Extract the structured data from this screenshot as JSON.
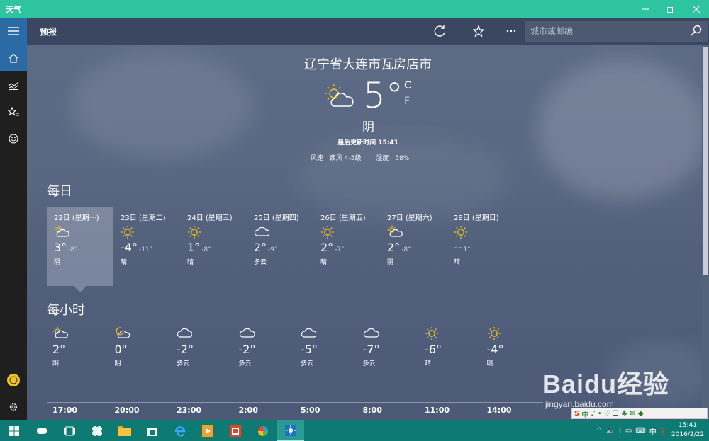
{
  "window": {
    "title": "天气"
  },
  "command_bar": {
    "page_title": "预报",
    "search_placeholder": "城市或邮编"
  },
  "current": {
    "location": "辽宁省大连市瓦房店市",
    "temperature": "5",
    "degree": "°",
    "unit_c": "C",
    "unit_f": "F",
    "condition": "阴",
    "updated": "最后更新时间 15:41",
    "wind_label": "风速",
    "wind_value": "西风 4-5级",
    "humidity_label": "湿度",
    "humidity_value": "58%"
  },
  "daily": {
    "title": "每日",
    "days": [
      {
        "date": "22日 (星期一)",
        "hi": "3°",
        "lo": "-8°",
        "desc": "阴",
        "icon": "partly-cloudy-icon"
      },
      {
        "date": "23日 (星期二)",
        "hi": "-4°",
        "lo": "-11°",
        "desc": "晴",
        "icon": "sun-icon"
      },
      {
        "date": "24日 (星期三)",
        "hi": "1°",
        "lo": "-8°",
        "desc": "晴",
        "icon": "sun-icon"
      },
      {
        "date": "25日 (星期四)",
        "hi": "2°",
        "lo": "-9°",
        "desc": "多云",
        "icon": "cloud-icon"
      },
      {
        "date": "26日 (星期五)",
        "hi": "2°",
        "lo": "-7°",
        "desc": "晴",
        "icon": "sun-icon"
      },
      {
        "date": "27日 (星期六)",
        "hi": "2°",
        "lo": "-8°",
        "desc": "阴",
        "icon": "partly-cloudy-icon"
      },
      {
        "date": "28日 (星期日)",
        "hi": "--",
        "lo": "1°",
        "desc": "晴",
        "icon": "sun-icon"
      }
    ]
  },
  "hourly": {
    "title": "每小时",
    "hours": [
      {
        "temp": "2°",
        "desc": "阴",
        "time": "17:00",
        "icon": "partly-cloudy-icon"
      },
      {
        "temp": "0°",
        "desc": "阴",
        "time": "20:00",
        "icon": "moon-cloud-icon"
      },
      {
        "temp": "-2°",
        "desc": "多云",
        "time": "23:00",
        "icon": "cloud-icon"
      },
      {
        "temp": "-2°",
        "desc": "多云",
        "time": "2:00",
        "icon": "cloud-icon"
      },
      {
        "temp": "-5°",
        "desc": "多云",
        "time": "5:00",
        "icon": "cloud-icon"
      },
      {
        "temp": "-7°",
        "desc": "多云",
        "time": "8:00",
        "icon": "cloud-icon"
      },
      {
        "temp": "-6°",
        "desc": "晴",
        "time": "11:00",
        "icon": "sun-icon"
      },
      {
        "temp": "-4°",
        "desc": "晴",
        "time": "14:00",
        "icon": "sun-icon"
      }
    ]
  },
  "taskbar": {
    "clock_time": "15:41",
    "clock_date": "2016/2/22",
    "ime": "中"
  },
  "watermark": {
    "brand": "Baidu经验",
    "url": "jingyan.baidu.com"
  },
  "colors": {
    "titlebar": "#2ec4a0",
    "accent": "#2c6aa6",
    "taskbar": "#0e7a74",
    "sun": "#f2c518"
  }
}
